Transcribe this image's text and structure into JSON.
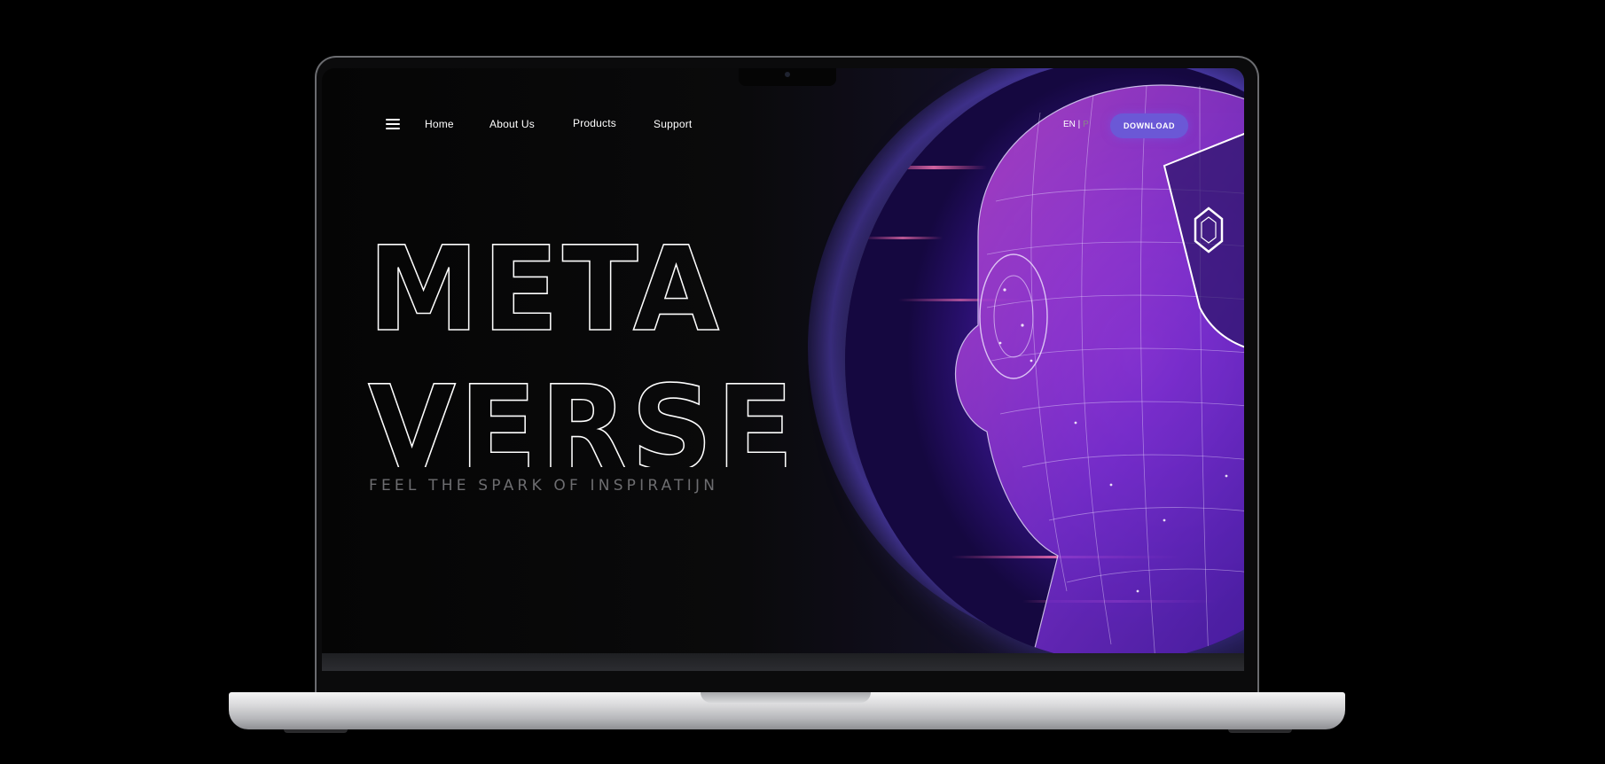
{
  "nav": {
    "items": [
      {
        "label": "Home"
      },
      {
        "label": "About Us"
      },
      {
        "label": "Products"
      },
      {
        "label": "Support"
      }
    ],
    "menu_icon": "hamburger-menu-icon"
  },
  "language": {
    "active": "EN",
    "separator": " |",
    "other": " P"
  },
  "download": {
    "label": "DOWNLOAD"
  },
  "hero": {
    "title_line1": "META",
    "title_line2": "VERSE",
    "tagline": "FEEL THE SPARK OF INSPIRATIJN",
    "image": "vr-wireframe-head"
  },
  "colors": {
    "accent": "#6b58d6",
    "background": "#050505",
    "glow": "#5a41c0",
    "text": "#ffffff",
    "tagline": "#6d6d70"
  }
}
